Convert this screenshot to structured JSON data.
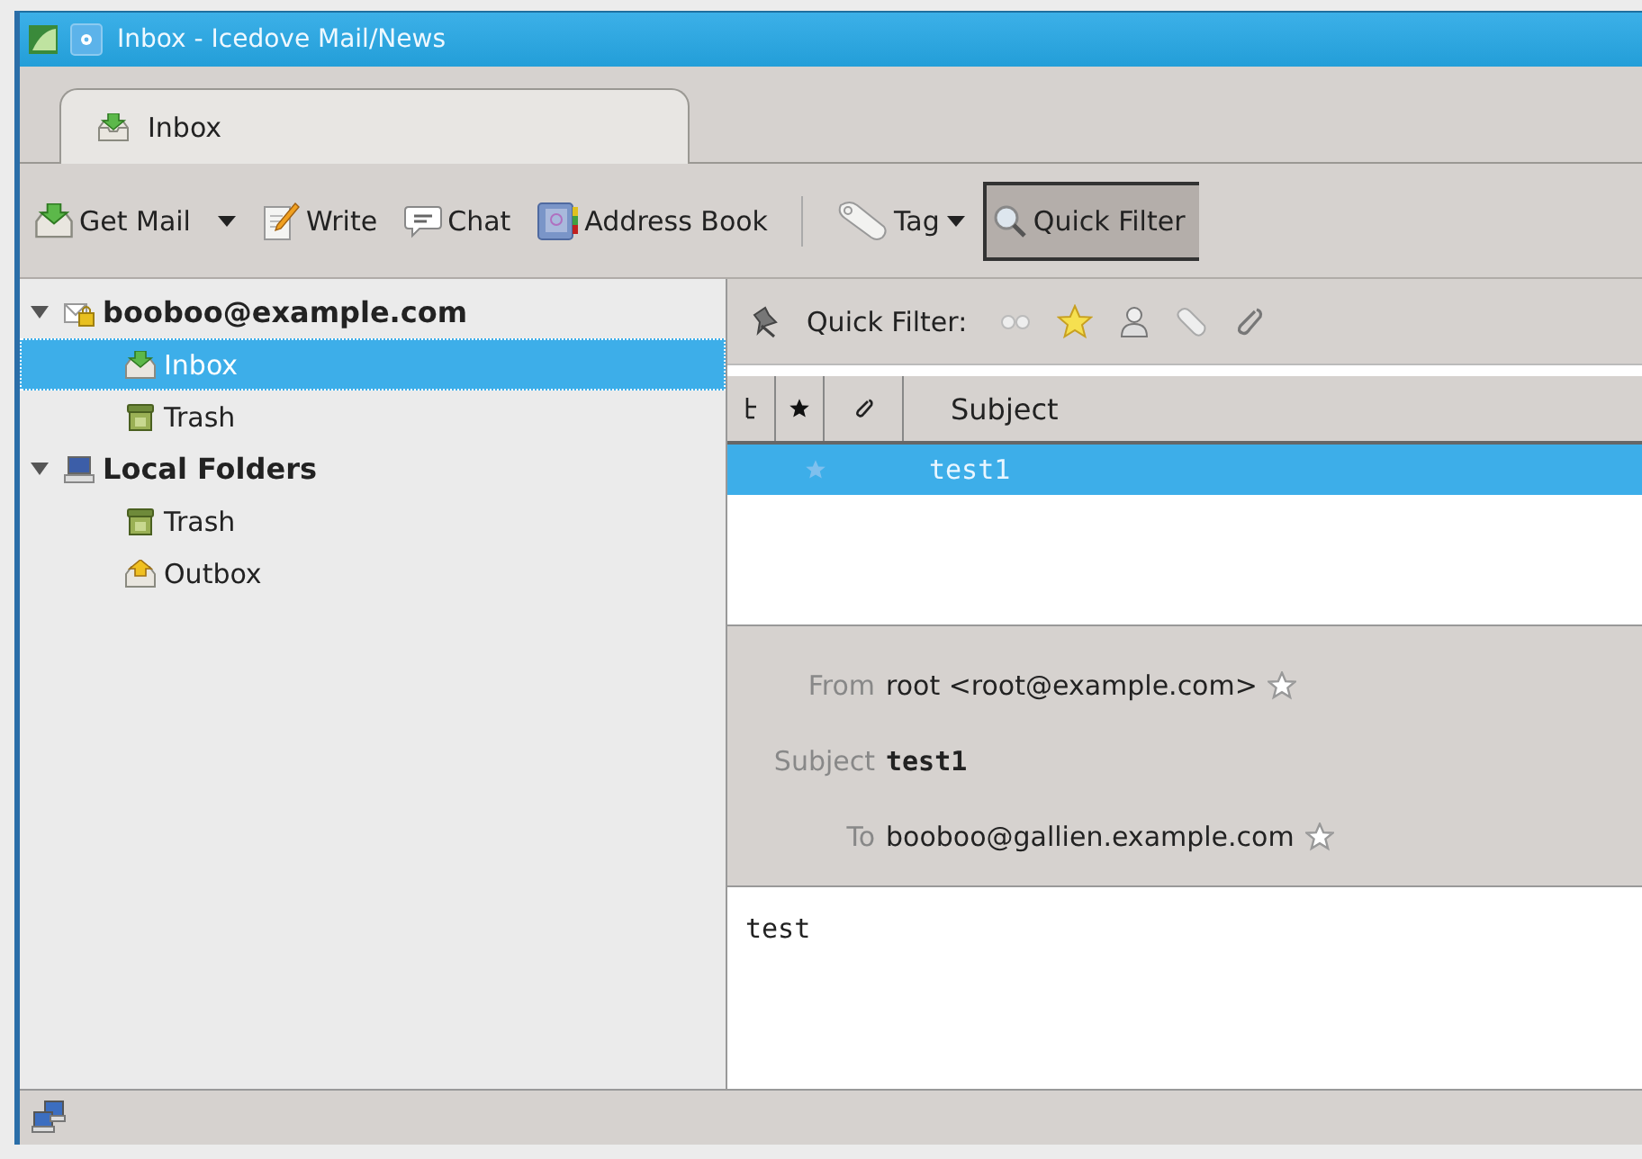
{
  "window": {
    "title": "Inbox - Icedove Mail/News"
  },
  "tabs": [
    {
      "label": "Inbox",
      "selected": true
    }
  ],
  "toolbar": [
    {
      "label": "Get Mail",
      "kind": "split",
      "pressed": false
    },
    {
      "label": "Write",
      "kind": "plain",
      "pressed": false
    },
    {
      "label": "Chat",
      "kind": "plain",
      "pressed": false
    },
    {
      "label": "Address Book",
      "kind": "plain",
      "pressed": false
    },
    {
      "label": "Tag",
      "kind": "menu",
      "pressed": false
    },
    {
      "label": "Quick Filter",
      "kind": "plain",
      "pressed": true
    }
  ],
  "folders": [
    {
      "name": "booboo@example.com",
      "expanded": true,
      "selected": false,
      "children": [
        {
          "name": "Inbox",
          "selected": true
        },
        {
          "name": "Trash",
          "selected": false
        }
      ]
    },
    {
      "name": "Local Folders",
      "expanded": true,
      "selected": false,
      "children": [
        {
          "name": "Trash",
          "selected": false
        },
        {
          "name": "Outbox",
          "selected": false
        }
      ]
    }
  ],
  "quick_filter": {
    "label": "Quick Filter:"
  },
  "message_list": {
    "columns": [
      "Subject"
    ],
    "rows": [
      {
        "subject": "test1",
        "starred": false,
        "selected": true
      }
    ]
  },
  "message_header": [
    {
      "label": "From",
      "value": "root <root@example.com>",
      "kind": "address"
    },
    {
      "label": "Subject",
      "value": "test1",
      "kind": "subject"
    },
    {
      "label": "To",
      "value": "booboo@gallien.example.com",
      "kind": "address"
    }
  ],
  "message_body": "test"
}
